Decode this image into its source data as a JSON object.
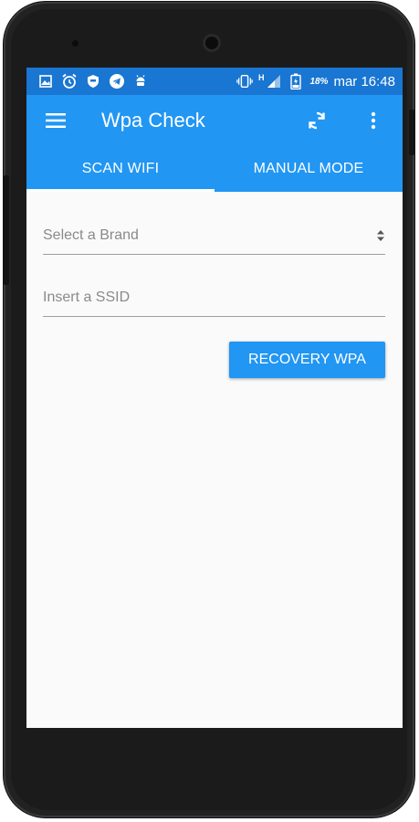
{
  "status_bar": {
    "battery_percent": "18%",
    "date_time": "mar 16:48",
    "network_label": "H",
    "icons": [
      "image-icon",
      "alarm-icon",
      "shield-icon",
      "telegram-icon",
      "android-icon",
      "vibrate-icon",
      "signal-icon",
      "battery-icon"
    ]
  },
  "app_bar": {
    "title": "Wpa Check",
    "icons": [
      "menu-icon",
      "refresh-icon",
      "more-vert-icon"
    ]
  },
  "tabs": [
    {
      "label": "SCAN WIFI",
      "active": true
    },
    {
      "label": "MANUAL MODE",
      "active": false
    }
  ],
  "form": {
    "brand_select_placeholder": "Select a Brand",
    "ssid_placeholder": "Insert a SSID",
    "recovery_button_label": "RECOVERY WPA"
  },
  "colors": {
    "status_bar": "#1976d2",
    "primary": "#2196f3",
    "background": "#fafafa",
    "hint_text": "#8a8a8a"
  }
}
